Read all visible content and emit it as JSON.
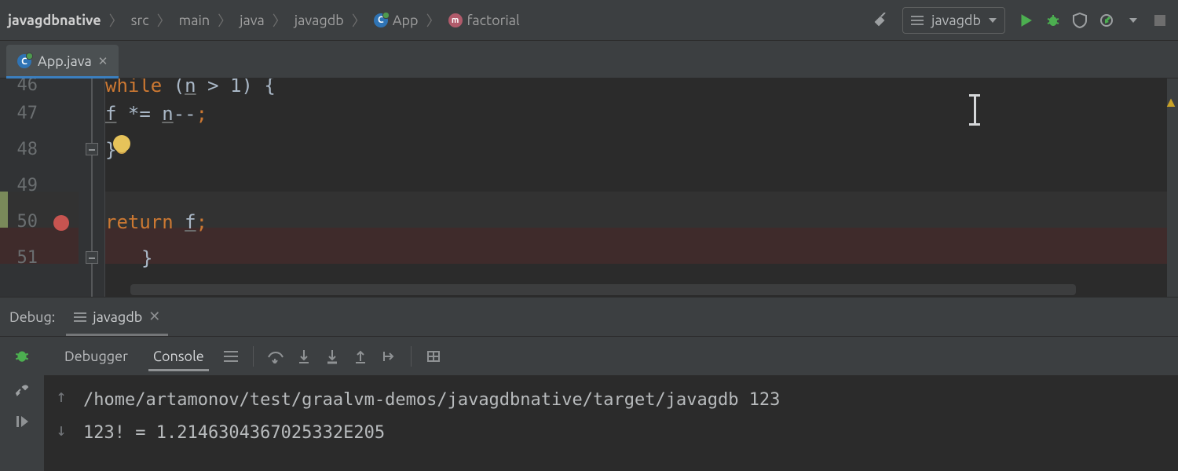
{
  "breadcrumbs": {
    "project": "javagdbnative",
    "parts": [
      "src",
      "main",
      "java",
      "javagdb"
    ],
    "class": "App",
    "member": "factorial"
  },
  "run_config": {
    "name": "javagdb"
  },
  "tab": {
    "filename": "App.java"
  },
  "editor": {
    "lines": [
      {
        "num": "46",
        "partial_kw": "while",
        "partial_rest": "(n > 1) {"
      },
      {
        "num": "47",
        "html": "f *= n--;"
      },
      {
        "num": "48",
        "html": "}"
      },
      {
        "num": "49",
        "html": ""
      },
      {
        "num": "50",
        "html": "return f;"
      },
      {
        "num": "51",
        "html": "}"
      }
    ]
  },
  "debug": {
    "title": "Debug:",
    "config": "javagdb",
    "subtabs": {
      "debugger": "Debugger",
      "console": "Console"
    },
    "console_lines": [
      "/home/artamonov/test/graalvm-demos/javagdbnative/target/javagdb 123",
      "123! = 1.2146304367025332E205"
    ]
  }
}
